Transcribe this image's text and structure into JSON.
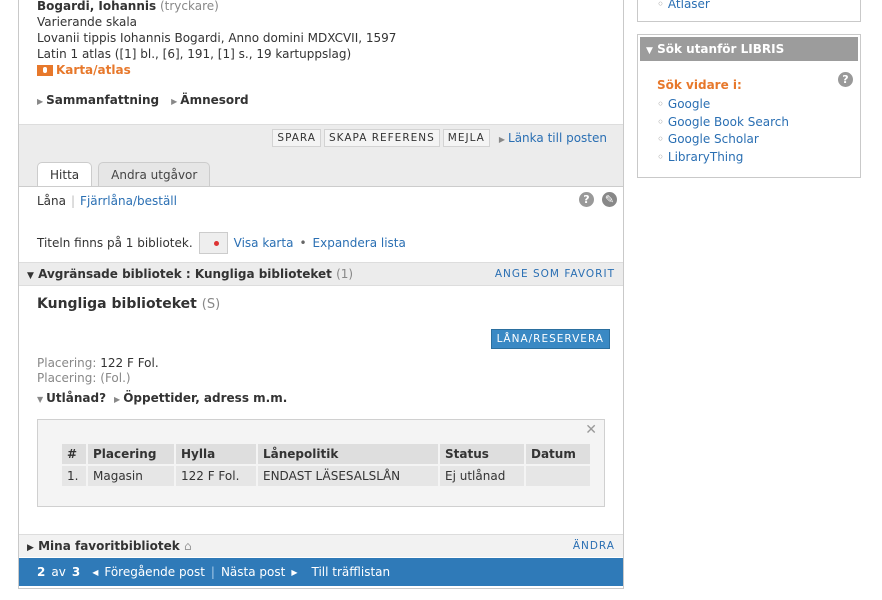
{
  "record": {
    "author": "Bogardi, Iohannis",
    "author_role": "(tryckare)",
    "scale": "Varierande skala",
    "publication": "Lovanii tippis Iohannis Bogardi, Anno domini MDXCVII, 1597",
    "description": "Latin 1 atlas ([1] bl., [6], 191, [1] s., 19 kartuppslag)",
    "type": "Karta/atlas",
    "toggles": [
      "Sammanfattning",
      "Ämnesord"
    ]
  },
  "actions": {
    "spara": "SPARA",
    "skapa": "SKAPA REFERENS",
    "mejla": "MEJLA",
    "lanka": "Länka till posten"
  },
  "tabs": [
    "Hitta",
    "Andra utgåvor"
  ],
  "find": {
    "lana": "Låna",
    "fjarr": "Fjärrlåna/beställ",
    "titeln": "Titeln finns på 1 bibliotek.",
    "visa_karta": "Visa karta",
    "expandera": "Expandera lista"
  },
  "library_section": {
    "heading": "Avgränsade bibliotek : Kungliga biblioteket",
    "count": "(1)",
    "favorite": "ANGE SOM FAVORIT",
    "name": "Kungliga biblioteket",
    "code": "(S)",
    "lana_reservera": "LÅNA/RESERVERA",
    "placering_label": "Placering:",
    "placering1": "122 F Fol.",
    "placering2": "(Fol.)",
    "utlanad": "Utlånad?",
    "oppettider": "Öppettider, adress m.m."
  },
  "holdings": {
    "headers": [
      "#",
      "Placering",
      "Hylla",
      "Lånepolitik",
      "Status",
      "Datum"
    ],
    "rows": [
      [
        "1.",
        "Magasin",
        "122 F Fol.",
        "ENDAST LÄSESALSLÅN",
        "Ej utlånad",
        ""
      ]
    ]
  },
  "favorites": {
    "label": "Mina favoritbibliotek",
    "andra": "ÄNDRA"
  },
  "nav": {
    "current": "2",
    "av": "av",
    "total": "3",
    "prev": "Föregående post",
    "next": "Nästa post",
    "list": "Till träfflistan"
  },
  "sidebar": {
    "top_link": "Atlaser",
    "heading": "Sök utanför LIBRIS",
    "sok_vidare": "Sök vidare i:",
    "links": [
      "Google",
      "Google Book Search",
      "Google Scholar",
      "LibraryThing"
    ]
  }
}
